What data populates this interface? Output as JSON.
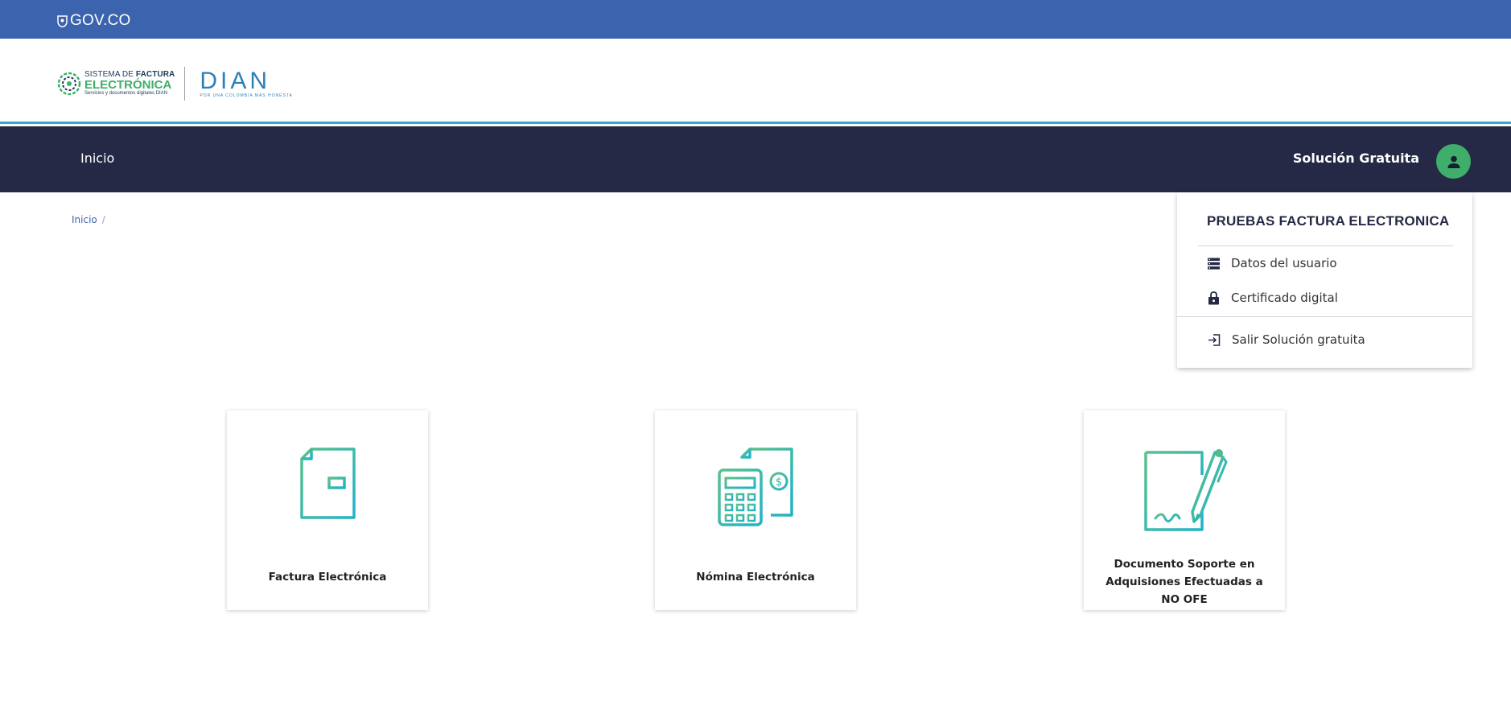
{
  "gov_bar": {
    "logo_text": "GOV.CO"
  },
  "brand": {
    "sfe_line1_a": "SISTEMA DE ",
    "sfe_line1_b": "FACTURA",
    "sfe_line2": "ELECTRÓNICA",
    "sfe_line3": "Servicios y documentos digitales DIAN",
    "dian_word": "DIAN",
    "dian_tagline": "POR UNA COLOMBIA MÁS HONESTA"
  },
  "navbar": {
    "home_label": "Inicio",
    "solution_label": "Solución Gratuita"
  },
  "breadcrumb": {
    "home": "Inicio",
    "separator": "/"
  },
  "user_menu": {
    "title": "PRUEBAS FACTURA ELECTRONICA",
    "items": [
      {
        "label": "Datos del usuario",
        "icon": "list-icon"
      },
      {
        "label": "Certificado digital",
        "icon": "lock-icon"
      },
      {
        "label": "Salir Solución gratuita",
        "icon": "logout-icon"
      }
    ]
  },
  "cards": [
    {
      "label": "Factura Electrónica",
      "icon": "invoice-icon"
    },
    {
      "label": "Nómina Electrónica",
      "icon": "payroll-calculator-icon"
    },
    {
      "label": "Documento Soporte en Adquisiones Efectuadas a NO OFE",
      "icon": "signed-document-icon"
    }
  ],
  "colors": {
    "gov_blue": "#3c63ad",
    "nav_dark": "#262945",
    "brand_green": "#3fae6b",
    "icon_gradient_start": "#5cc08a",
    "icon_gradient_end": "#1fb3c9"
  }
}
